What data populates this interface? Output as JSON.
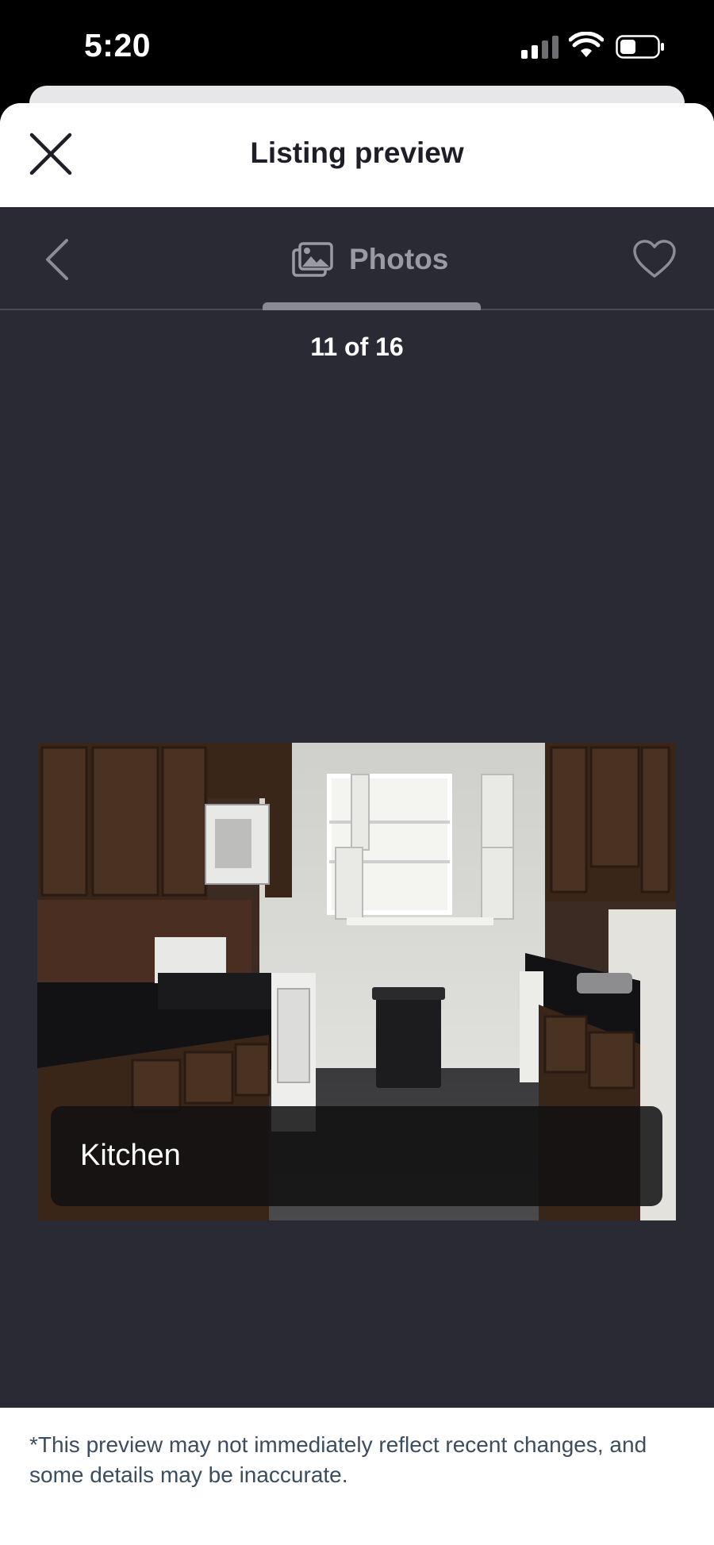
{
  "status_bar": {
    "time": "5:20"
  },
  "header": {
    "title": "Listing preview",
    "close_icon": "close-icon"
  },
  "nav": {
    "back_icon": "chevron-left-icon",
    "tab_icon": "photos-icon",
    "tab_label": "Photos",
    "favorite_icon": "heart-outline-icon"
  },
  "photo_viewer": {
    "counter": "11 of 16",
    "current_index": 11,
    "total": 16,
    "caption": "Kitchen"
  },
  "footer": {
    "note": "*This preview may not immediately reflect recent changes, and some details may be inaccurate."
  },
  "colors": {
    "viewer_background": "#2a2a35",
    "header_background": "#ffffff",
    "title_text": "#1e1e28",
    "footer_text": "#3b4d5e"
  }
}
